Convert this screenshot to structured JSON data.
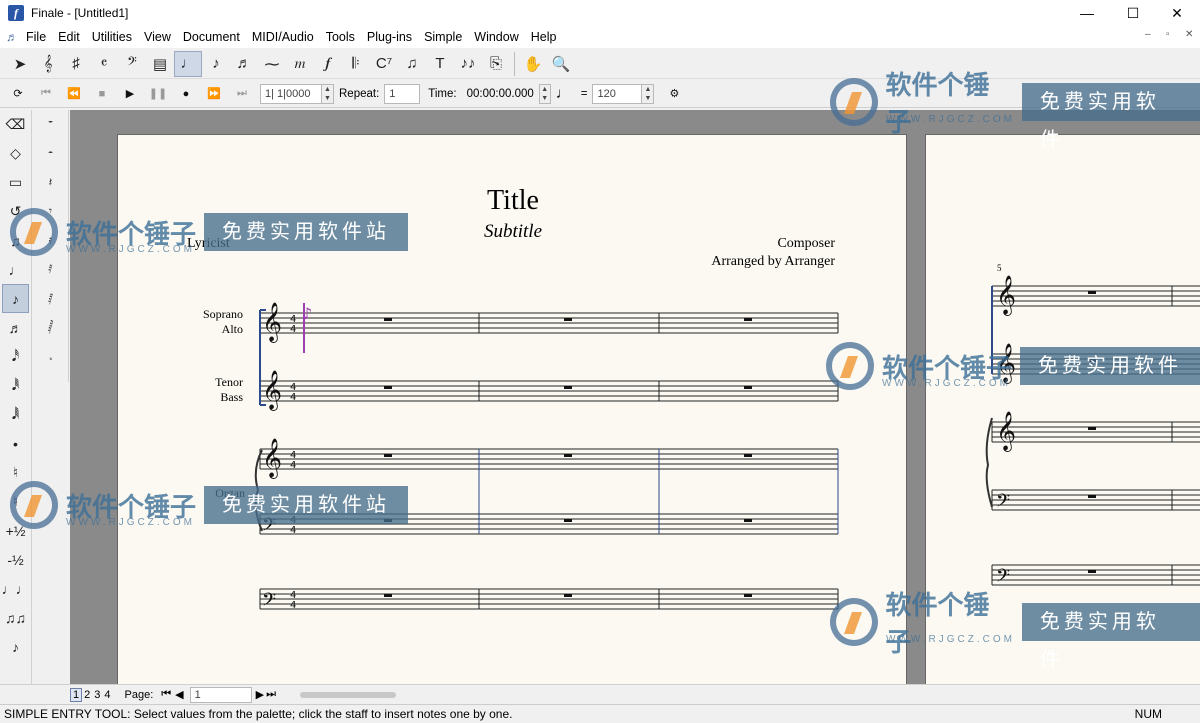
{
  "window": {
    "title": "Finale - [Untitled1]",
    "controls": [
      "—",
      "☐",
      "✕"
    ]
  },
  "menu": [
    "File",
    "Edit",
    "Utilities",
    "View",
    "Document",
    "MIDI/Audio",
    "Tools",
    "Plug-ins",
    "Simple",
    "Window",
    "Help"
  ],
  "mdi_controls": [
    "–",
    "▫",
    "✕"
  ],
  "main_tools": [
    {
      "name": "selection-tool",
      "glyph": "➤"
    },
    {
      "name": "staff-tool",
      "glyph": "𝄞"
    },
    {
      "name": "key-signature-tool",
      "glyph": "♯"
    },
    {
      "name": "time-signature-tool",
      "glyph": "𝄴"
    },
    {
      "name": "clef-tool",
      "glyph": "𝄢"
    },
    {
      "name": "measure-tool",
      "glyph": "▤"
    },
    {
      "name": "simple-entry-tool",
      "glyph": "♩",
      "active": true
    },
    {
      "name": "speedy-entry-tool",
      "glyph": "♪"
    },
    {
      "name": "tuplet-tool",
      "glyph": "♬"
    },
    {
      "name": "smart-shape-tool",
      "glyph": "⁓"
    },
    {
      "name": "articulation-tool",
      "glyph": "𝆐"
    },
    {
      "name": "expression-tool",
      "glyph": "𝆑"
    },
    {
      "name": "repeat-tool",
      "glyph": "𝄆"
    },
    {
      "name": "chord-tool",
      "glyph": "C⁷"
    },
    {
      "name": "lyrics-tool",
      "glyph": "♫"
    },
    {
      "name": "text-tool",
      "glyph": "T"
    },
    {
      "name": "mirror-tool",
      "glyph": "♪♪"
    },
    {
      "name": "page-layout-tool",
      "glyph": "⎘"
    },
    {
      "name": "hand-grabber-tool",
      "glyph": "✋"
    },
    {
      "name": "zoom-tool",
      "glyph": "🔍"
    }
  ],
  "playback": {
    "counter": "1| 1|0000",
    "repeat_label": "Repeat:",
    "repeat_value": "1",
    "time_label": "Time:",
    "time_value": "00:00:00.000",
    "tempo_equals": "=",
    "tempo_value": "120"
  },
  "palette_main": [
    "⌫",
    "◇",
    "▭",
    "↺",
    "♫",
    "♩",
    "♪",
    "♬",
    "𝅘𝅥𝅰",
    "𝅘𝅥𝅱",
    "𝅘𝅥𝅲",
    "•",
    "♮",
    "♮",
    "+½",
    "-½",
    "♩♩",
    "♫♫",
    "♪"
  ],
  "palette_rests": [
    "𝄻",
    "𝄼",
    "𝄽",
    "𝄾",
    "𝄿",
    "𝅀",
    "𝅁",
    "𝅂",
    "𝅃"
  ],
  "score": {
    "title": "Title",
    "subtitle": "Subtitle",
    "composer": "Composer",
    "arranger": "Arranged by Arranger",
    "lyricist": "Lyricist",
    "staves": [
      {
        "label1": "Soprano",
        "label2": "Alto"
      },
      {
        "label1": "Tenor",
        "label2": "Bass"
      },
      {
        "label1": "Organ",
        "label2": ""
      }
    ],
    "measure_number": "5"
  },
  "pagebar": {
    "pages": [
      "1",
      "2",
      "3",
      "4"
    ],
    "page_label": "Page:",
    "page_value": "1"
  },
  "status": {
    "message": "SIMPLE ENTRY TOOL: Select values from the palette; click the staff to insert notes one by one.",
    "num": "NUM"
  },
  "watermark": {
    "brand": "软件个锤子",
    "url": "WWW.RJGCZ.COM",
    "tag": "免费实用软件站",
    "tag_cut": "免费实用软件"
  }
}
